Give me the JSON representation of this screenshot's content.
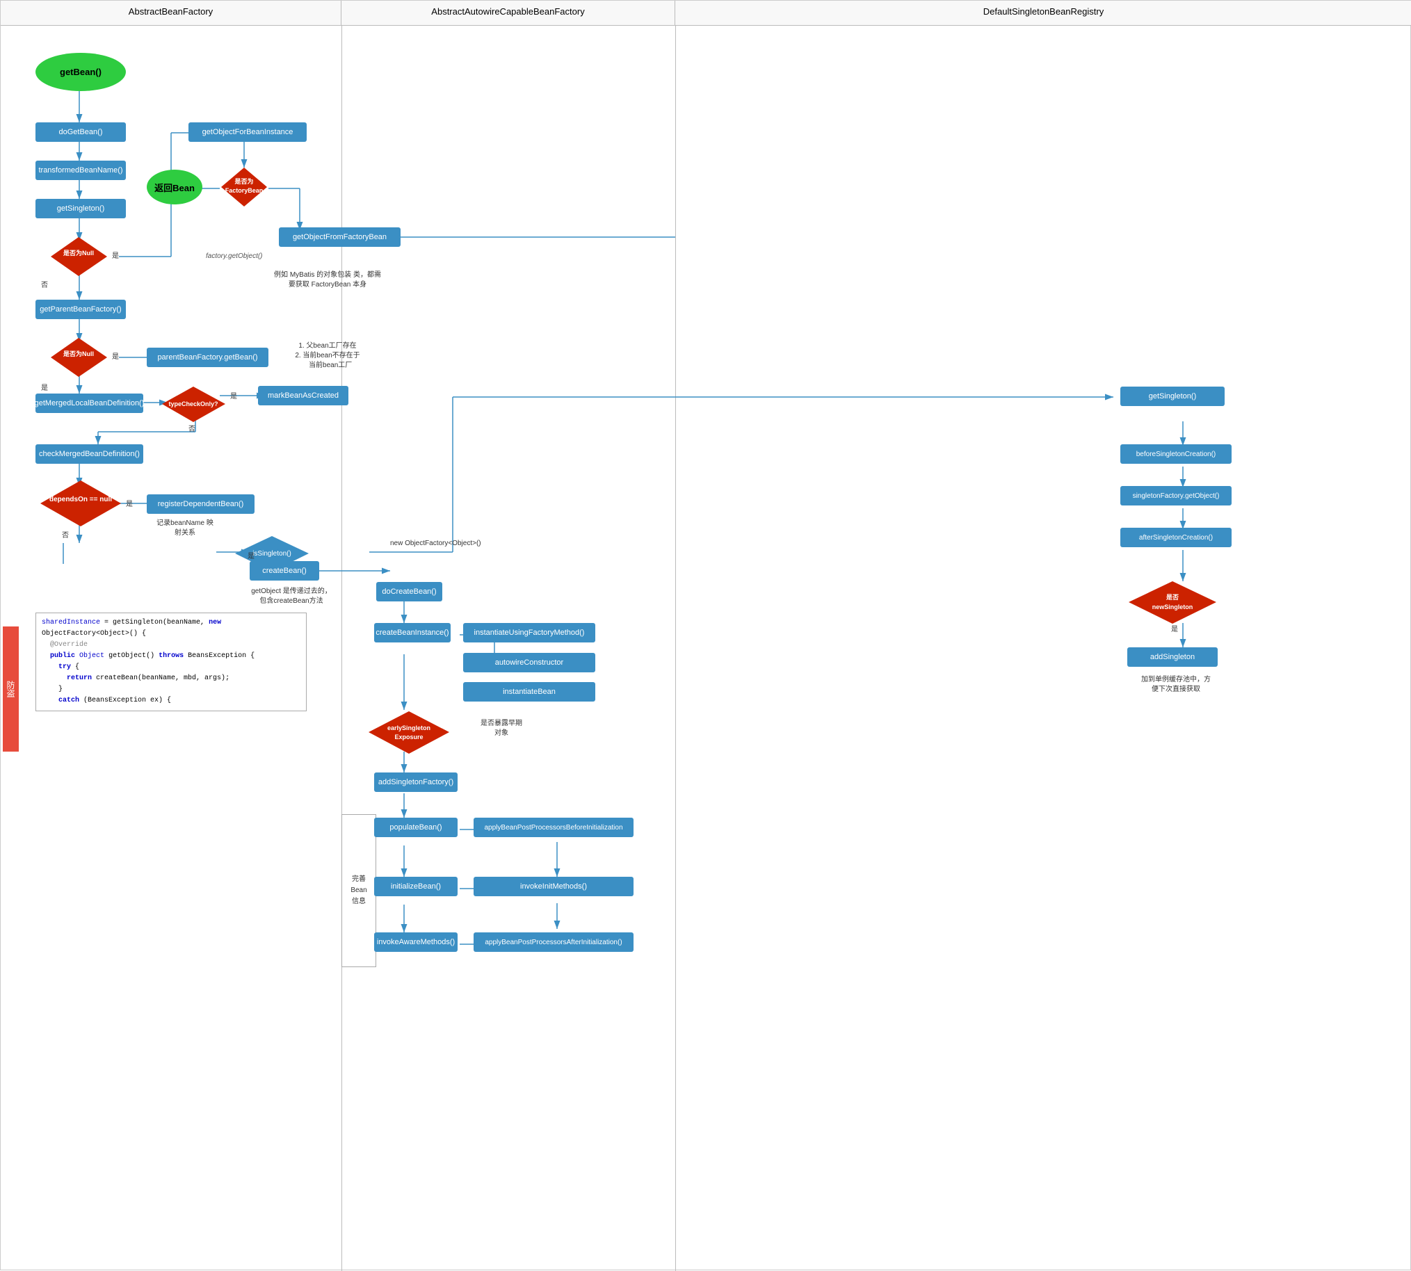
{
  "columns": [
    {
      "id": "col1",
      "label": "AbstractBeanFactory"
    },
    {
      "id": "col2",
      "label": "AbstractAutowireCapableBeanFactory"
    },
    {
      "id": "col3",
      "label": "DefaultSingletonBeanRegistry"
    }
  ],
  "nodes": {
    "getBean": {
      "label": "getBean()",
      "type": "oval-green"
    },
    "doGetBean": {
      "label": "doGetBean()"
    },
    "getObjectForBeanInstance": {
      "label": "getObjectForBeanInstance"
    },
    "transformedBeanName": {
      "label": "transformedBeanName()"
    },
    "isFactoryBean": {
      "label": "是否为\nFactoryBean",
      "type": "diamond-red"
    },
    "getSingleton1": {
      "label": "getSingleton()"
    },
    "returnBean": {
      "label": "返回Bean",
      "type": "oval-green"
    },
    "getObjectFromFactoryBean": {
      "label": "getObjectFromFactoryBean"
    },
    "isNull1": {
      "label": "是否为Null",
      "type": "diamond-red"
    },
    "getParentBeanFactory": {
      "label": "getParentBeanFactory()"
    },
    "isNull2": {
      "label": "是否为Null",
      "type": "diamond-red"
    },
    "parentBeanFactoryGetBean": {
      "label": "parentBeanFactory.getBean()"
    },
    "getMergedLocalBeanDefinition": {
      "label": "getMergedLocalBeanDefinition()"
    },
    "typeCheckOnly": {
      "label": "typeCheckOnly?",
      "type": "diamond-red"
    },
    "markBeanAsCreated": {
      "label": "markBeanAsCreated"
    },
    "checkMergedBeanDefinition": {
      "label": "checkMergedBeanDefinition()"
    },
    "dependsOnNull": {
      "label": "dependsOn == null",
      "type": "diamond-red"
    },
    "registerDependentBean": {
      "label": "registerDependentBean()"
    },
    "isSingleton": {
      "label": "isSingleton()"
    },
    "createBean": {
      "label": "createBean()"
    },
    "doCreateBean": {
      "label": "doCreateBean()"
    },
    "instantiateUsingFactoryMethod": {
      "label": "instantiateUsingFactoryMethod()"
    },
    "createBeanInstance": {
      "label": "createBeanInstance()"
    },
    "autowireConstructor": {
      "label": "autowireConstructor"
    },
    "instantiateBean": {
      "label": "instantiateBean"
    },
    "earlySingletonExposure": {
      "label": "earlySingletonExposure",
      "type": "diamond-red"
    },
    "addSingletonFactory": {
      "label": "addSingletonFactory()"
    },
    "populateBean": {
      "label": "populateBean()"
    },
    "initializeBean": {
      "label": "initializeBean()"
    },
    "invokeAwareMethods": {
      "label": "invokeAwareMethods()"
    },
    "applyBefore": {
      "label": "applyBeanPostProcessorsBeforeInitialization"
    },
    "invokeInitMethods": {
      "label": "invokeInitMethods()"
    },
    "applyAfter": {
      "label": "applyBeanPostProcessorsAfterInitialization()"
    },
    "getSingleton2": {
      "label": "getSingleton()"
    },
    "beforeSingletonCreation": {
      "label": "beforeSingletonCreation()"
    },
    "singletonFactoryGetObject": {
      "label": "singletonFactory.getObject()"
    },
    "afterSingletonCreation": {
      "label": "afterSingletonCreation()"
    },
    "isNewSingleton": {
      "label": "是否\nnewSingleton",
      "type": "diamond-red"
    },
    "addSingleton": {
      "label": "addSingleton"
    }
  },
  "code": {
    "lines": [
      {
        "type": "normal",
        "text": "sharedInstance = getSingleton(beanName, new ObjectFactory<Object>() {"
      },
      {
        "type": "annotation",
        "text": "    @Override"
      },
      {
        "type": "normal",
        "text": "    public Object getObject() throws BeansException {"
      },
      {
        "type": "normal",
        "text": "        try {"
      },
      {
        "type": "normal",
        "text": "            return createBean(beanName, mbd, args);"
      },
      {
        "type": "normal",
        "text": "        }"
      },
      {
        "type": "normal",
        "text": "        catch (BeansException ex) {"
      }
    ]
  },
  "notes": {
    "factoryGetObject": "factory.getObject()",
    "factoryBeanNote": "例如 MyBatis 的对象包装\n类，都需要获取\nFactoryBean 本身",
    "parentBeanNote": "1. 父bean工厂存在\n2. 当前bean不存在于\n   当前bean工厂",
    "getObjectNote": "getObject 是传递过去的，\n包含createBean方法",
    "beanNameNote": "记录beanName 映\n射关系",
    "isEarlyNote": "是否暴露早期\n对象",
    "addSingletonNote": "加到单例缓存池中，方\n便下次直接获取",
    "completeBeanNote": "完善\nBean\n信息"
  },
  "labels": {
    "yes": "是",
    "no": "否",
    "newObjectFactory": "new ObjectFactory<Object>()"
  }
}
